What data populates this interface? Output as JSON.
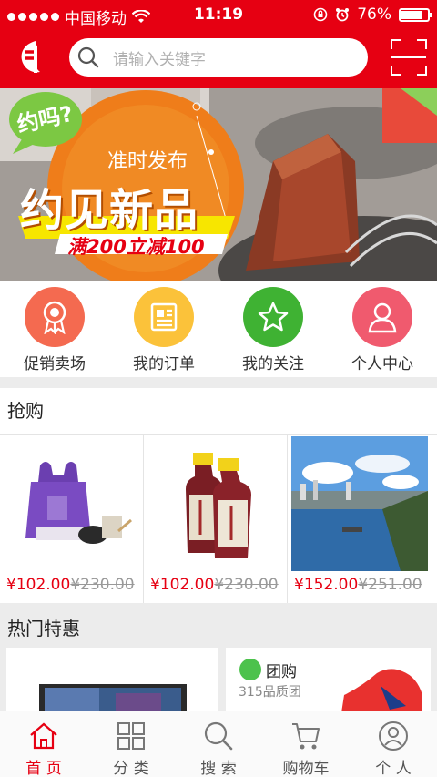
{
  "status": {
    "carrier": "中国移动",
    "time": "11:19",
    "battery": "76%"
  },
  "search": {
    "placeholder": "请输入关键字"
  },
  "banner": {
    "badge": "约吗?",
    "tagline": "准时发布",
    "headline": "约见新品",
    "offer": "满200立减100"
  },
  "quick_nav": [
    {
      "label": "促销卖场",
      "icon": "medal-icon",
      "color": "#f46a50"
    },
    {
      "label": "我的订单",
      "icon": "order-icon",
      "color": "#fbc23a"
    },
    {
      "label": "我的关注",
      "icon": "star-icon",
      "color": "#3fb233"
    },
    {
      "label": "个人中心",
      "icon": "user-icon",
      "color": "#f05a6e"
    }
  ],
  "flash_sale": {
    "title": "抢购",
    "items": [
      {
        "price": "¥102.00",
        "old_price": "¥230.00"
      },
      {
        "price": "¥102.00",
        "old_price": "¥230.00"
      },
      {
        "price": "¥152.00",
        "old_price": "¥251.00"
      }
    ]
  },
  "hot_deals": {
    "title": "热门特惠",
    "group_buy": {
      "title": "团购",
      "subtitle": "315品质团"
    }
  },
  "tabbar": [
    {
      "label": "首 页",
      "icon": "home-icon",
      "active": true
    },
    {
      "label": "分 类",
      "icon": "category-icon",
      "active": false
    },
    {
      "label": "搜 索",
      "icon": "search-icon",
      "active": false
    },
    {
      "label": "购物车",
      "icon": "cart-icon",
      "active": false
    },
    {
      "label": "个 人",
      "icon": "person-icon",
      "active": false
    }
  ],
  "colors": {
    "brand": "#e60012",
    "price": "#e60012"
  }
}
